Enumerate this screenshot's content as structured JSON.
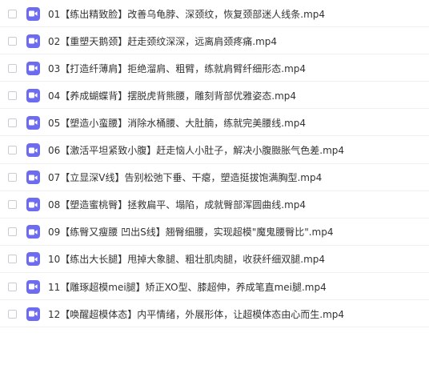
{
  "colors": {
    "icon_bg": "#6d6cf0",
    "text": "#333333",
    "divider": "#f0f0f0",
    "checkbox_border": "#c8ccd4"
  },
  "files": [
    {
      "name": "01【练出精致脸】改善乌龟脖、深颈纹，恢复颈部迷人线条.mp4",
      "icon": "video-file-icon"
    },
    {
      "name": "02【重塑天鹅颈】赶走颈纹深深，远离肩颈疼痛.mp4",
      "icon": "video-file-icon"
    },
    {
      "name": "03【打造纤薄肩】拒绝溜肩、粗臂，练就肩臂纤细形态.mp4",
      "icon": "video-file-icon"
    },
    {
      "name": "04【养成蝴蝶背】摆脱虎背熊腰，雕刻背部优雅姿态.mp4",
      "icon": "video-file-icon"
    },
    {
      "name": "05【塑造小蛮腰】消除水桶腰、大肚腩，练就完美腰线.mp4",
      "icon": "video-file-icon"
    },
    {
      "name": "06【激活平坦紧致小腹】赶走恼人小肚子，解决小腹臌胀气色差.mp4",
      "icon": "video-file-icon"
    },
    {
      "name": "07【立显深V线】告别松弛下垂、干瘪，塑造挺拔饱满胸型.mp4",
      "icon": "video-file-icon"
    },
    {
      "name": "08【塑造蜜桃臀】拯救扁平、塌陷，成就臀部浑圆曲线.mp4",
      "icon": "video-file-icon"
    },
    {
      "name": "09【练臀又瘦腰 凹出S线】翘臀细腰，实现超模\"魔鬼腰臀比\".mp4",
      "icon": "video-file-icon"
    },
    {
      "name": "10【练出大长腿】甩掉大象腿、粗壮肌肉腿，收获纤细双腿.mp4",
      "icon": "video-file-icon"
    },
    {
      "name": "11【雕琢超模mei腿】矫正XO型、膝超伸，养成笔直mei腿.mp4",
      "icon": "video-file-icon"
    },
    {
      "name": "12【唤醒超模体态】内平情绪，外展形体，让超模体态由心而生.mp4",
      "icon": "video-file-icon"
    }
  ]
}
